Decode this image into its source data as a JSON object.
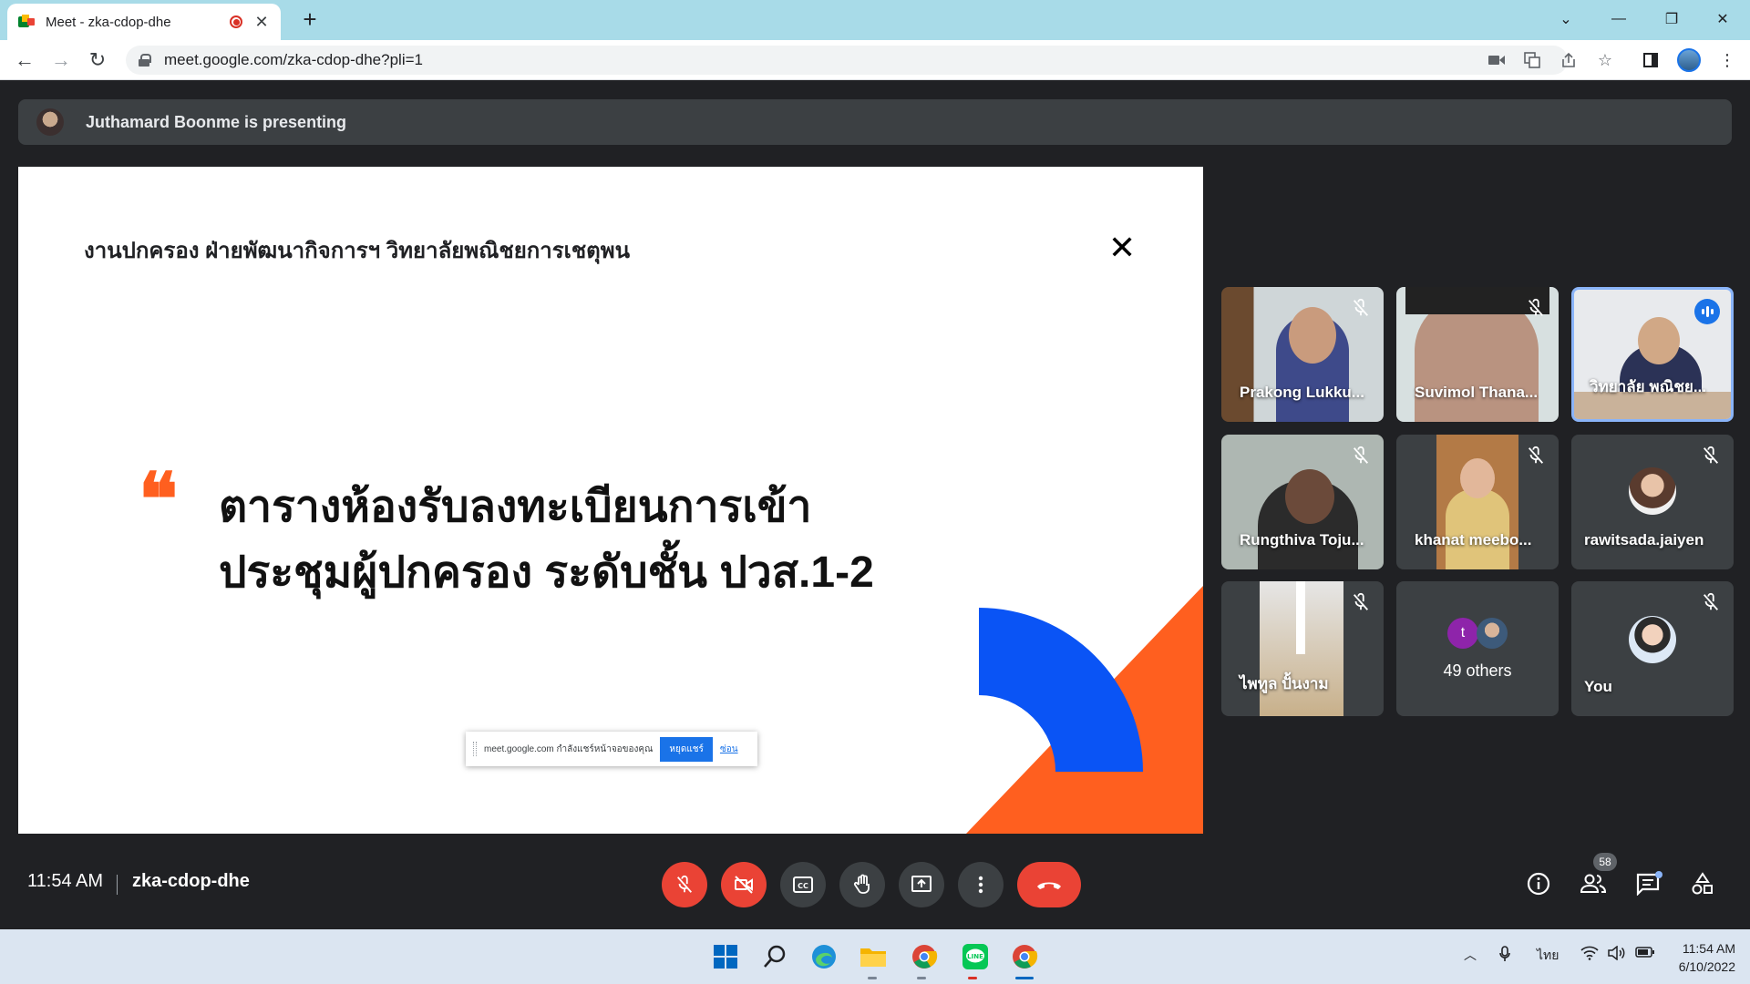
{
  "browser": {
    "tab_title": "Meet - zka-cdop-dhe",
    "url": "meet.google.com/zka-cdop-dhe?pli=1"
  },
  "presenting_banner": "Juthamard Boonme is presenting",
  "slide": {
    "header": "งานปกครอง ฝ่ายพัฒนากิจการฯ วิทยาลัยพณิชยการเชตุพน",
    "title_line1": "ตารางห้องรับลงทะเบียนการเข้า",
    "title_line2": "ประชุมผู้ปกครอง ระดับชั้น ปวส.1-2",
    "quote_mark": "❝",
    "share_notice": {
      "text": "meet.google.com กำลังแชร์หน้าจอของคุณ",
      "stop_label": "หยุดแชร์",
      "hide_label": "ซ่อน"
    }
  },
  "participants": [
    {
      "name": "Prakong Lukku...",
      "muted": true
    },
    {
      "name": "Suvimol Thana...",
      "muted": true
    },
    {
      "name": "วิทยาลัย พณิชย...",
      "speaking": true
    },
    {
      "name": "Rungthiva Toju...",
      "muted": true
    },
    {
      "name": "khanat meebo...",
      "muted": true
    },
    {
      "name": "rawitsada.jaiyen",
      "muted": true
    },
    {
      "name": "ไพทูล ปั้นงาม",
      "muted": true
    },
    {
      "name": "49 others",
      "others_initial": "t"
    },
    {
      "name": "You",
      "muted": true
    }
  ],
  "toolbar": {
    "time": "11:54 AM",
    "meeting_code": "zka-cdop-dhe",
    "people_count": "58"
  },
  "taskbar": {
    "language": "ไทย",
    "time": "11:54 AM",
    "date": "6/10/2022"
  },
  "colors": {
    "meet_bg": "#202124",
    "accent_orange": "#ff5f1f",
    "accent_blue": "#0a54f5",
    "danger_red": "#ea4335"
  }
}
